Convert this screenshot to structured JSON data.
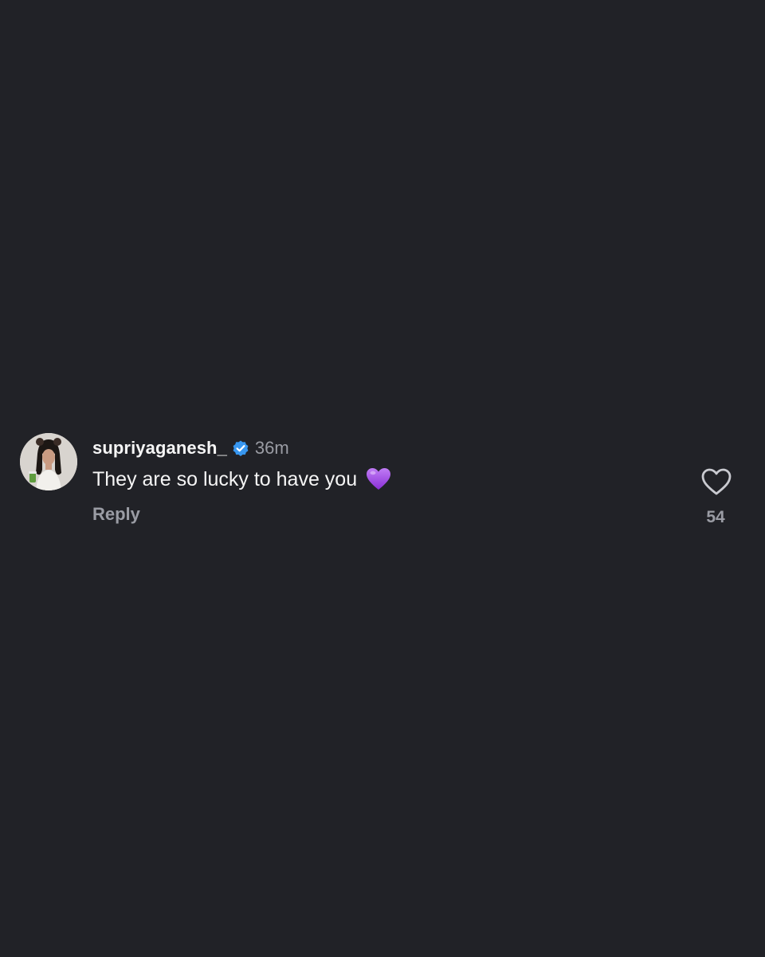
{
  "comment": {
    "avatar_icon": "user-avatar-photo",
    "username": "supriyaganesh_",
    "verified_icon": "verified-badge-icon",
    "timestamp": "36m",
    "text": "They are so lucky to have you",
    "emoji": "purple-heart-emoji",
    "reply_label": "Reply",
    "like_icon": "heart-outline-icon",
    "like_count": "54"
  },
  "colors": {
    "background": "#212227",
    "text_primary": "#f5f5f5",
    "text_secondary": "#9a9ca4",
    "verified_blue": "#3897f0",
    "purple_heart": "#a64ce8"
  }
}
